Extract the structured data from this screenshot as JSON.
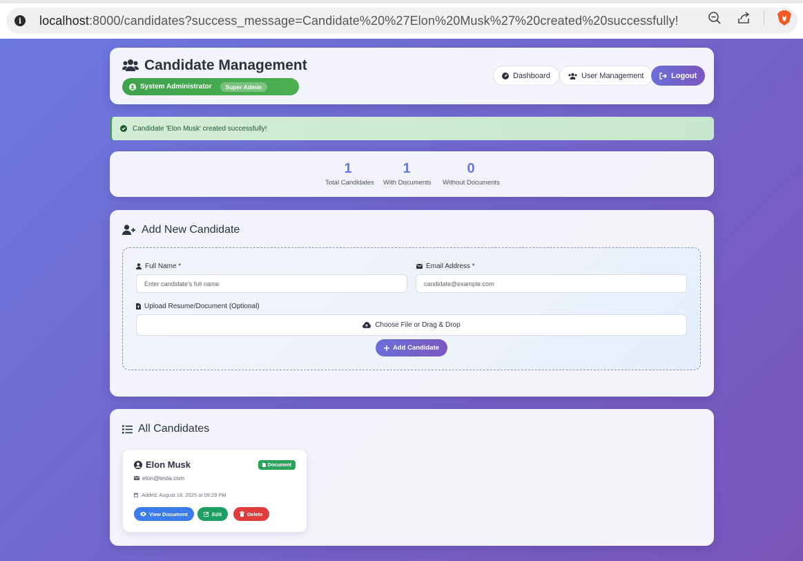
{
  "browser": {
    "url_host": "localhost",
    "url_rest": ":8000/candidates?success_message=Candidate%20%27Elon%20Musk%27%20created%20successfully!",
    "icons": [
      "info-icon",
      "zoom-out-icon",
      "share-icon",
      "brave-lion-icon"
    ]
  },
  "header": {
    "title": "Candidate Management",
    "role_label": "System Administrator",
    "role_badge": "Super Admin",
    "nav": {
      "dashboard": "Dashboard",
      "user_management": "User Management",
      "logout": "Logout"
    }
  },
  "alert": {
    "message": "Candidate 'Elon Musk' created successfully!"
  },
  "stats": [
    {
      "value": "1",
      "label": "Total Candidates"
    },
    {
      "value": "1",
      "label": "With Documents"
    },
    {
      "value": "0",
      "label": "Without Documents"
    }
  ],
  "add_form": {
    "title": "Add New Candidate",
    "full_name_label": "Full Name *",
    "full_name_placeholder": "Enter candidate's full name",
    "email_label": "Email Address *",
    "email_placeholder": "candidate@example.com",
    "upload_label": "Upload Resume/Document (Optional)",
    "upload_button": "Choose File or Drag & Drop",
    "submit": "Add Candidate"
  },
  "list": {
    "title": "All Candidates",
    "candidates": [
      {
        "name": "Elon Musk",
        "email": "elon@tesla.com",
        "added": "Added: August 18, 2025 at 09:29 PM",
        "badge": "Document",
        "actions": {
          "view": "View Document",
          "edit": "Edit",
          "delete": "Delete"
        }
      }
    ]
  },
  "colors": {
    "accent": "#6b6fd8",
    "success": "#4caf50",
    "danger": "#e03c3c",
    "info": "#3b7bea"
  }
}
